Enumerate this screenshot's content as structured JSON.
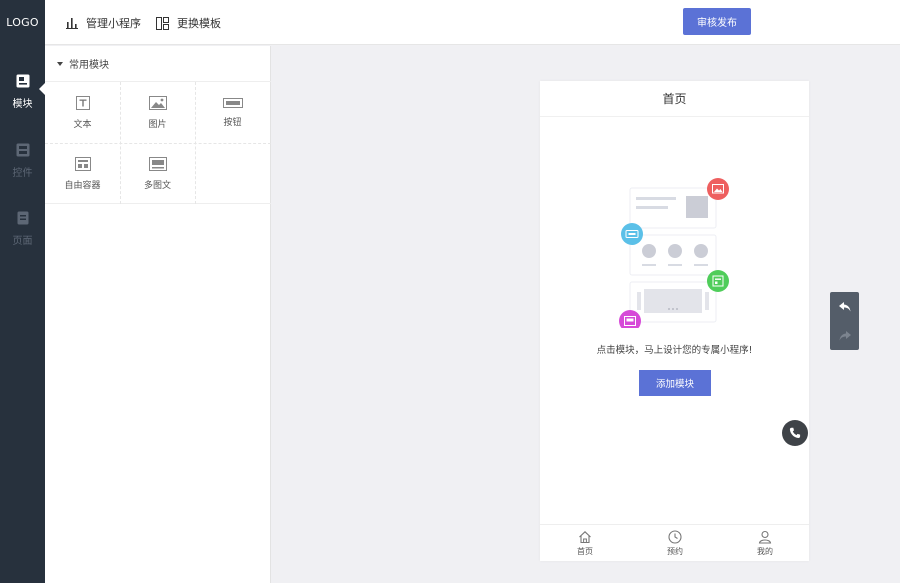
{
  "app": {
    "logo_text": "LOGO"
  },
  "rail": {
    "items": [
      {
        "label": "模块",
        "icon": "module-icon",
        "active": true
      },
      {
        "label": "控件",
        "icon": "widget-icon",
        "active": false
      },
      {
        "label": "页面",
        "icon": "page-icon",
        "active": false
      }
    ]
  },
  "header": {
    "manage_label": "管理小程序",
    "template_label": "更换模板",
    "publish_label": "审核发布"
  },
  "panel": {
    "section_title": "常用模块",
    "modules": [
      {
        "label": "文本",
        "icon": "text-icon"
      },
      {
        "label": "图片",
        "icon": "image-icon"
      },
      {
        "label": "按钮",
        "icon": "button-icon"
      },
      {
        "label": "自由容器",
        "icon": "container-icon"
      },
      {
        "label": "多图文",
        "icon": "multi-image-text-icon"
      }
    ]
  },
  "phone": {
    "title": "首页",
    "hint": "点击模块，马上设计您的专属小程序!",
    "add_label": "添加模块",
    "tabs": [
      {
        "label": "首页",
        "icon": "home-icon"
      },
      {
        "label": "预约",
        "icon": "clock-icon"
      },
      {
        "label": "我的",
        "icon": "user-icon"
      }
    ]
  },
  "colors": {
    "accent": "#5b72d6",
    "rail_bg": "#27313d",
    "canvas_bg": "#f0f0f3",
    "badge_red": "#ee5f5f",
    "badge_blue": "#5bc0e8",
    "badge_green": "#4fcd5a",
    "badge_magenta": "#d64ad8"
  }
}
